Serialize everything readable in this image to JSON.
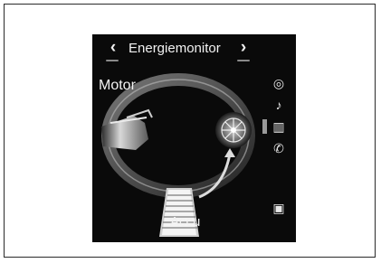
{
  "screen": {
    "title": "Energiemonitor",
    "nav_prev_glyph": "‹",
    "nav_next_glyph": "›"
  },
  "labels": {
    "motor": "Motor",
    "accu": "Accu"
  },
  "sidebar": {
    "items": [
      {
        "icon": "navigation-icon",
        "glyph": "◎"
      },
      {
        "icon": "music-note-icon",
        "glyph": "♪"
      },
      {
        "icon": "energy-graph-icon",
        "glyph": "▥",
        "active": true
      },
      {
        "icon": "phone-icon",
        "glyph": "✆"
      },
      {
        "icon": "media-icon",
        "glyph": "▣"
      }
    ]
  },
  "colors": {
    "screen_background": "#0a0a0a",
    "text": "#f2f2f2",
    "frame_border": "#2a2a2a"
  }
}
